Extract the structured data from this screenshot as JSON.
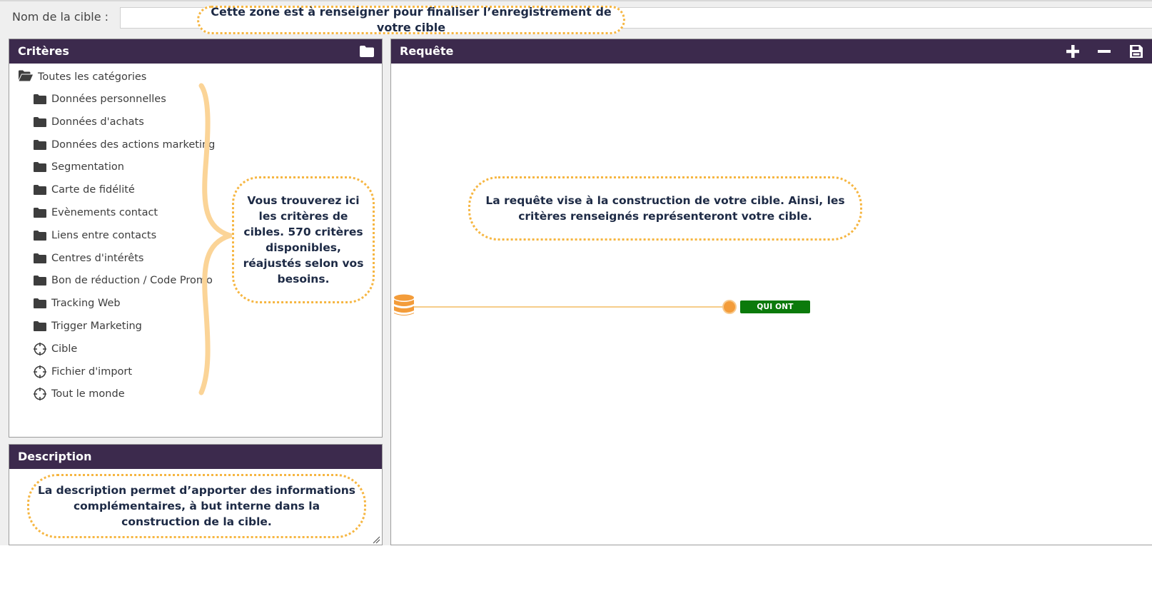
{
  "name_row": {
    "label": "Nom de la cible :",
    "input_value": "",
    "hint": "Cette zone est à renseigner pour finaliser l’enregistrement de votre cible"
  },
  "criteria_panel": {
    "title": "Critères",
    "root": {
      "label": "Toutes les catégories",
      "icon": "folder-open-icon"
    },
    "items": [
      {
        "label": "Données personnelles",
        "icon": "folder-icon"
      },
      {
        "label": "Données d'achats",
        "icon": "folder-icon"
      },
      {
        "label": "Données des actions marketing",
        "icon": "folder-icon"
      },
      {
        "label": "Segmentation",
        "icon": "folder-icon"
      },
      {
        "label": "Carte de fidélité",
        "icon": "folder-icon"
      },
      {
        "label": "Evènements contact",
        "icon": "folder-icon"
      },
      {
        "label": "Liens entre contacts",
        "icon": "folder-icon"
      },
      {
        "label": "Centres d'intérêts",
        "icon": "folder-icon"
      },
      {
        "label": "Bon de réduction / Code Promo",
        "icon": "folder-icon"
      },
      {
        "label": "Tracking Web",
        "icon": "folder-icon"
      },
      {
        "label": "Trigger Marketing",
        "icon": "folder-icon"
      },
      {
        "label": "Cible",
        "icon": "crosshair-icon"
      },
      {
        "label": "Fichier d'import",
        "icon": "crosshair-icon"
      },
      {
        "label": "Tout le monde",
        "icon": "crosshair-icon"
      }
    ],
    "hint": "Vous trouverez ici les critères de cibles. 570 critères disponibles, réajustés selon vos besoins."
  },
  "description_panel": {
    "title": "Description",
    "hint": "La description permet d’apporter des informations complémentaires, à but interne dans la construction de la cible."
  },
  "requete_panel": {
    "title": "Requête",
    "hint": "La requête vise à la construction de votre cible. Ainsi, les critères renseignés représenteront votre cible.",
    "badge": "QUI ONT"
  },
  "colors": {
    "header": "#3c2a4d",
    "accent_orange": "#f39c3a",
    "callout_border": "#f6b642",
    "badge_green": "#0b7a0b"
  }
}
